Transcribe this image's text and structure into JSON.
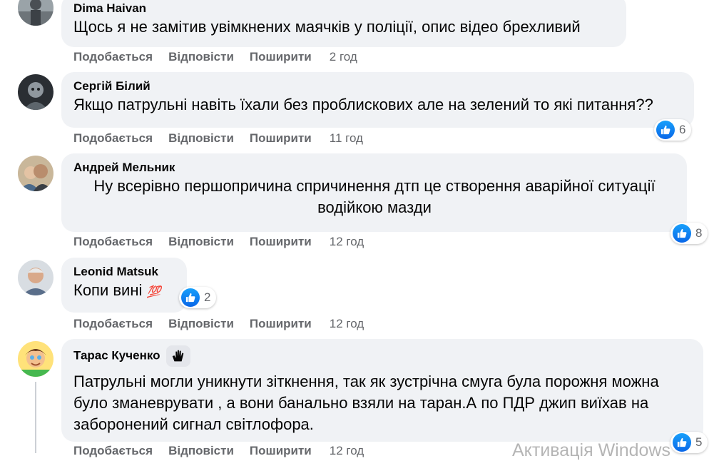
{
  "comments": [
    {
      "author": "Dima Haivan",
      "text": "Щось я не замітив увімкнених маячків у поліції, опис відео брехливий",
      "like": "Подобається",
      "reply": "Відповісти",
      "share": "Поширити",
      "time": "2 год"
    },
    {
      "author": "Сергій Білий",
      "text": "Якщо патрульні навіть їхали без проблискових але на зелений то які питання??",
      "like": "Подобається",
      "reply": "Відповісти",
      "share": "Поширити",
      "time": "11 год",
      "reactions": "6"
    },
    {
      "author": "Андрей Мельник",
      "text": "Ну всерівно першопричина спричинення дтп це створення аварійної ситуації водійкою мазди",
      "like": "Подобається",
      "reply": "Відповісти",
      "share": "Поширити",
      "time": "12 год",
      "reactions": "8"
    },
    {
      "author": "Leonid Matsuk",
      "text": "Копи вині",
      "emoji": "💯",
      "like": "Подобається",
      "reply": "Відповісти",
      "share": "Поширити",
      "time": "12 год",
      "reactions": "2"
    },
    {
      "author": "Тарас Кученко",
      "text": "Патрульні могли уникнути зіткнення, так як зустрічна смуга була порожня можна було зманеврувати , а вони банально взяли на таран.А по ПДР джип виїхав на заборонений сигнал світлофора.",
      "like": "Подобається",
      "reply": "Відповісти",
      "share": "Поширити",
      "time": "12 год",
      "reactions": "5"
    }
  ],
  "watermark": "Активація Windows",
  "colors": {
    "bubble": "#f0f2f5",
    "meta": "#65676b",
    "like": "#0a67e8"
  }
}
